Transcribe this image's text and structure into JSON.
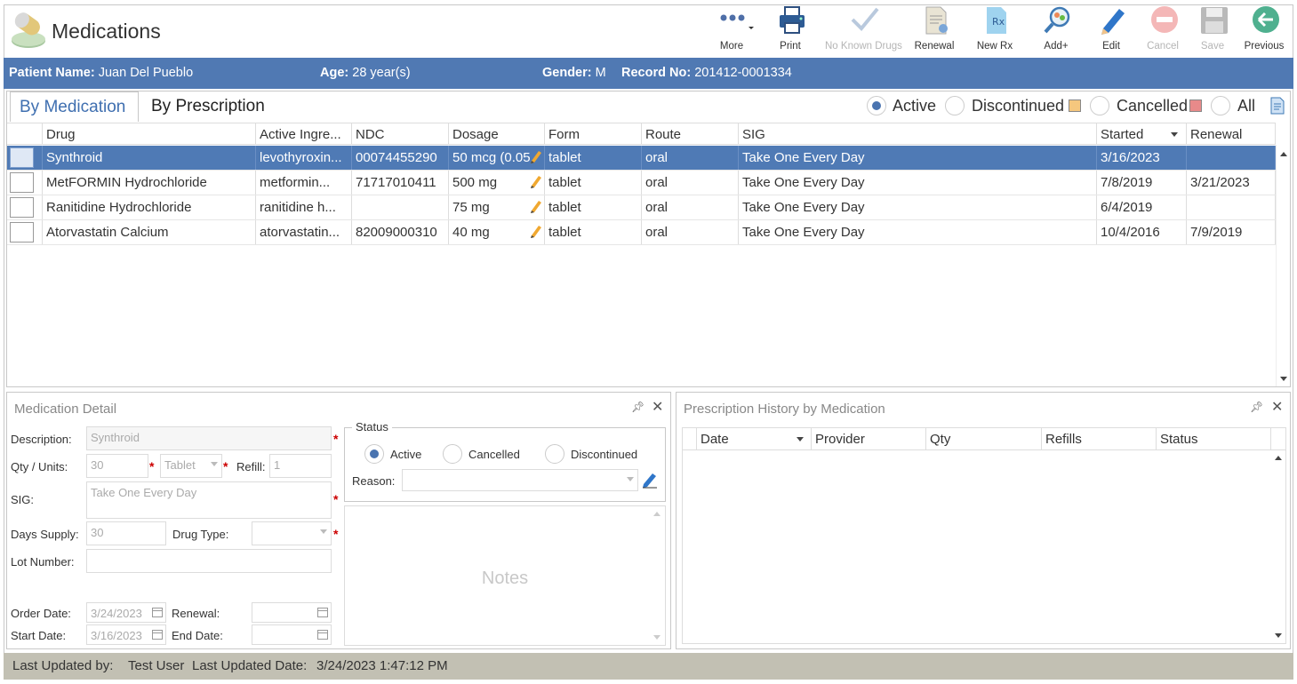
{
  "app": {
    "title": "Medications",
    "icon": "pill-bottle-icon"
  },
  "toolbar": {
    "more": "More",
    "print": "Print",
    "no_known_drugs": "No Known Drugs",
    "renewal": "Renewal",
    "new_rx": "New Rx",
    "add": "Add+",
    "edit": "Edit",
    "cancel": "Cancel",
    "save": "Save",
    "previous": "Previous"
  },
  "patient": {
    "name_label": "Patient Name:",
    "name": "Juan Del Pueblo",
    "age_label": "Age:",
    "age": "28 year(s)",
    "gender_label": "Gender:",
    "gender": "M",
    "record_label": "Record No:",
    "record": "201412-0001334"
  },
  "tabs": {
    "by_medication": "By Medication",
    "by_prescription": "By Prescription"
  },
  "filters": {
    "active": "Active",
    "discontinued": "Discontinued",
    "cancelled": "Cancelled",
    "all": "All",
    "selected": "Active"
  },
  "colors": {
    "accent": "#5079b3",
    "discontinued": "#f5c77e",
    "cancelled": "#e88a8a",
    "status_bar": "#c2c0b3"
  },
  "grid": {
    "columns": [
      "Drug",
      "Active Ingre...",
      "NDC",
      "Dosage",
      "Form",
      "Route",
      "SIG",
      "Started",
      "Renewal"
    ],
    "rows": [
      {
        "drug": "Synthroid",
        "ingredient": "levothyroxin...",
        "ndc": "00074455290",
        "dosage": "50 mcg (0.05",
        "form": "tablet",
        "route": "oral",
        "sig": "Take One Every Day",
        "started": "3/16/2023",
        "renewal": ""
      },
      {
        "drug": "MetFORMIN Hydrochloride",
        "ingredient": "metformin...",
        "ndc": "71717010411",
        "dosage": "500 mg",
        "form": "tablet",
        "route": "oral",
        "sig": "Take One Every Day",
        "started": "7/8/2019",
        "renewal": "3/21/2023"
      },
      {
        "drug": "Ranitidine Hydrochloride",
        "ingredient": "ranitidine h...",
        "ndc": "",
        "dosage": "75 mg",
        "form": "tablet",
        "route": "oral",
        "sig": "Take One Every Day",
        "started": "6/4/2019",
        "renewal": ""
      },
      {
        "drug": "Atorvastatin Calcium",
        "ingredient": "atorvastatin...",
        "ndc": "82009000310",
        "dosage": "40 mg",
        "form": "tablet",
        "route": "oral",
        "sig": "Take One Every Day",
        "started": "10/4/2016",
        "renewal": "7/9/2019"
      }
    ]
  },
  "detail": {
    "title": "Medication Detail",
    "description_label": "Description:",
    "description": "Synthroid",
    "qty_label": "Qty / Units:",
    "qty": "30",
    "units": "Tablet",
    "refill_label": "Refill:",
    "refill": "1",
    "sig_label": "SIG:",
    "sig": "Take One Every Day",
    "days_supply_label": "Days Supply:",
    "days_supply": "30",
    "drug_type_label": "Drug Type:",
    "drug_type": "",
    "lot_label": "Lot Number:",
    "lot": "",
    "order_date_label": "Order Date:",
    "order_date": "3/24/2023",
    "renewal_label": "Renewal:",
    "renewal": "",
    "start_date_label": "Start Date:",
    "start_date": "3/16/2023",
    "end_date_label": "End Date:",
    "end_date": "",
    "status_legend": "Status",
    "status_active": "Active",
    "status_cancelled": "Cancelled",
    "status_discontinued": "Discontinued",
    "status_selected": "Active",
    "reason_label": "Reason:",
    "reason": "",
    "notes_placeholder": "Notes"
  },
  "history": {
    "title": "Prescription History by Medication",
    "columns": [
      "Date",
      "Provider",
      "Qty",
      "Refills",
      "Status"
    ]
  },
  "footer": {
    "updated_by_label": "Last Updated by:",
    "updated_by": "Test User",
    "updated_date_label": "Last Updated Date:",
    "updated_date": "3/24/2023 1:47:12 PM"
  }
}
